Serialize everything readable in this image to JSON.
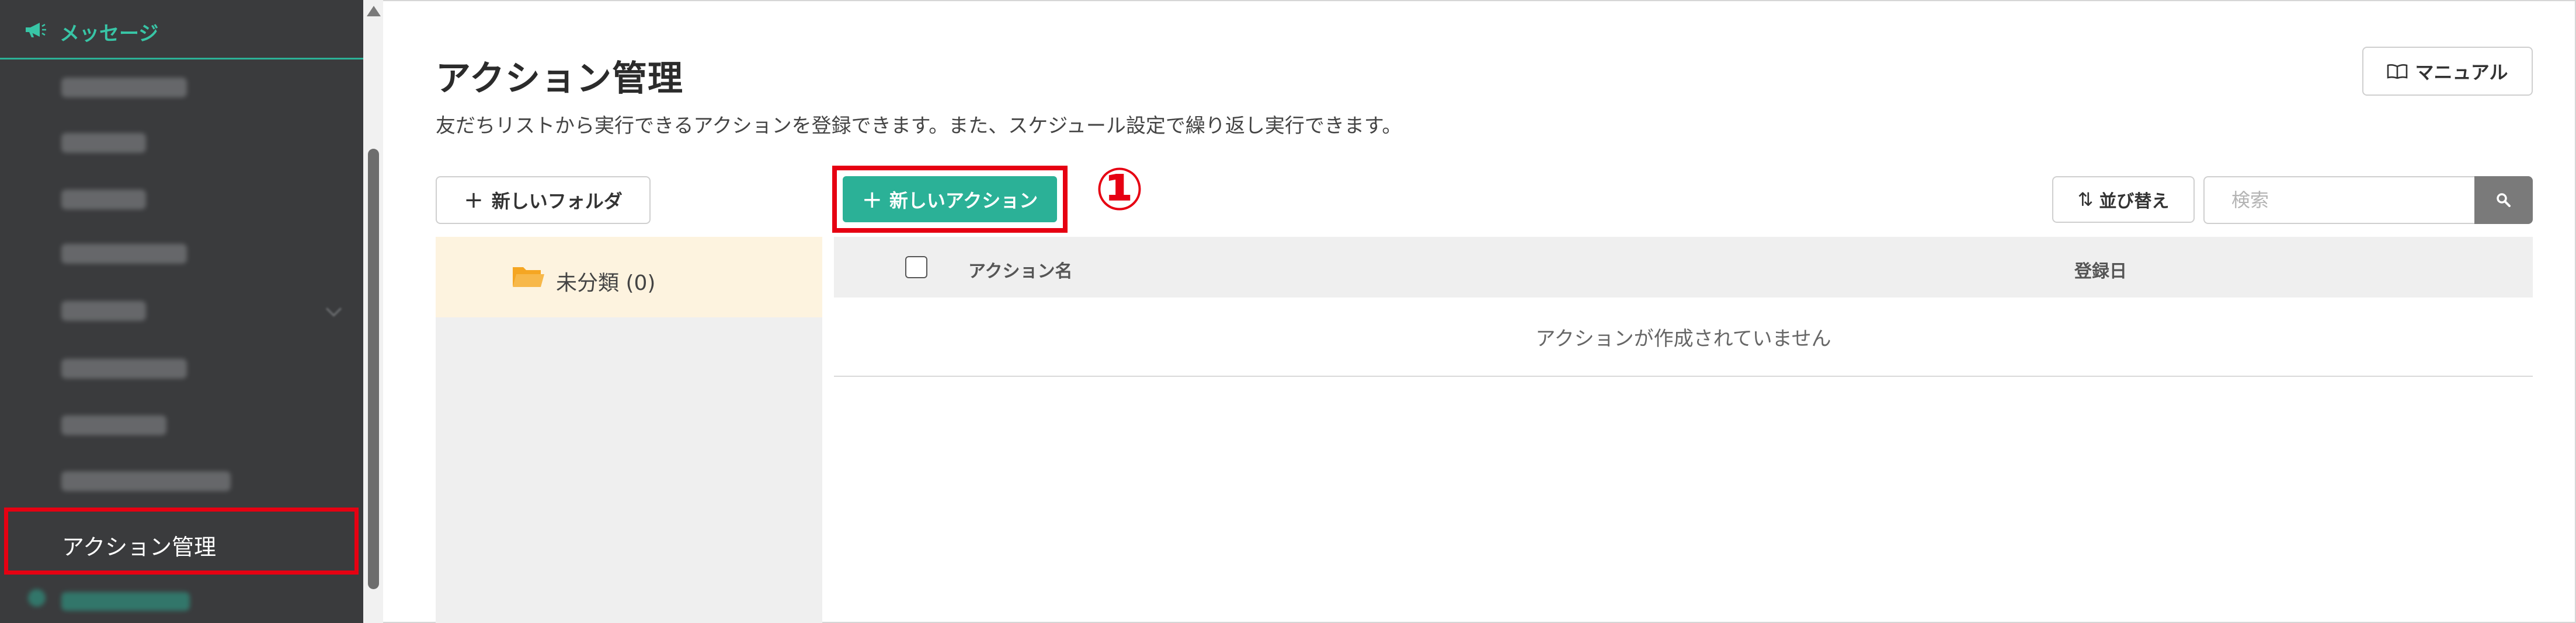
{
  "sidebar": {
    "section_label": "メッセージ",
    "active_item": "アクション管理"
  },
  "header": {
    "title": "アクション管理",
    "description": "友だちリストから実行できるアクションを登録できます。また、スケジュール設定で繰り返し実行できます。",
    "manual_label": "マニュアル"
  },
  "toolbar": {
    "new_folder_label": "新しいフォルダ",
    "new_action_label": "新しいアクション",
    "step_marker": "①",
    "sort_label": "並び替え",
    "search_placeholder": "検索"
  },
  "folders": {
    "items": [
      {
        "label": "未分類 (0)"
      }
    ]
  },
  "table": {
    "columns": [
      "アクション名",
      "登録日"
    ],
    "empty_message": "アクションが作成されていません"
  },
  "colors": {
    "accent": "#2bb197",
    "highlight": "#e60012",
    "sidebar_bg": "#3a3b3d",
    "folder_selected_bg": "#fdf3df",
    "folder_icon": "#f5a623"
  },
  "icons": {
    "section": "megaphone-icon",
    "manual": "book-icon",
    "plus": "plus-icon",
    "sort": "sort-arrows-icon",
    "search": "search-icon",
    "folder": "folder-icon"
  }
}
